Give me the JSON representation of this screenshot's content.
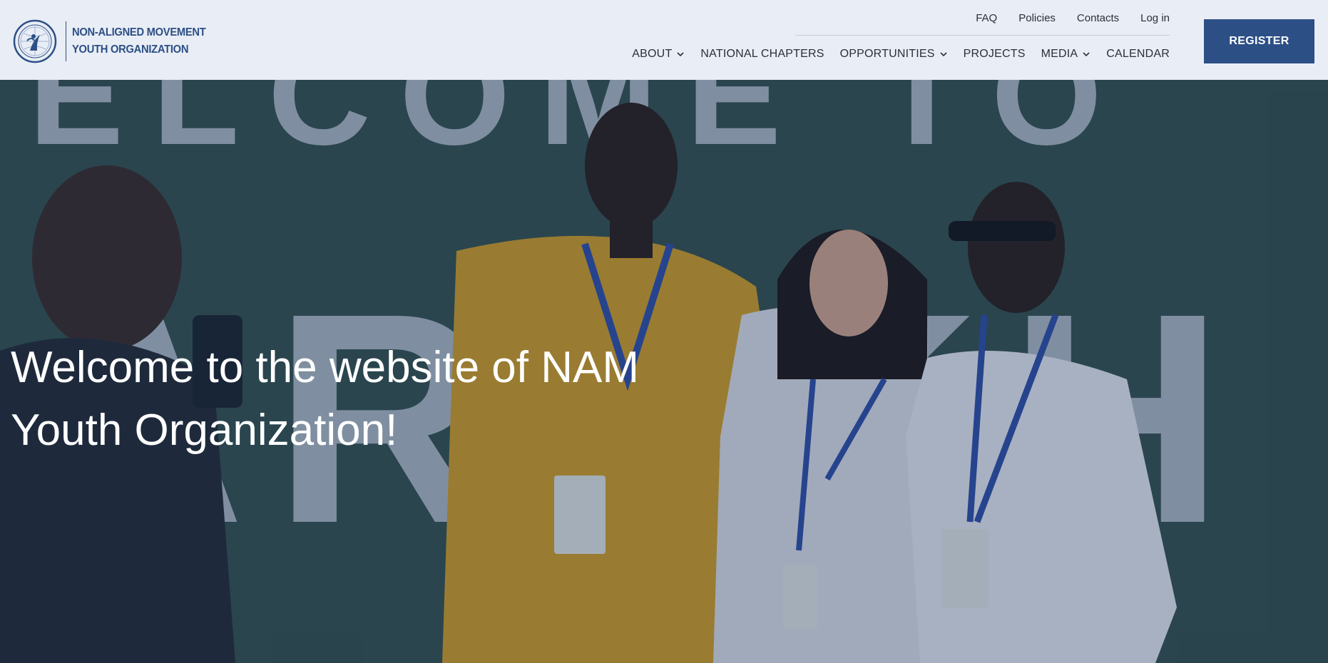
{
  "header": {
    "logo_line1": "NON-ALIGNED MOVEMENT",
    "logo_line2": "YOUTH ORGANIZATION",
    "top_links": [
      "FAQ",
      "Policies",
      "Contacts",
      "Log in"
    ],
    "nav": [
      {
        "label": "ABOUT",
        "dropdown": true
      },
      {
        "label": "NATIONAL CHAPTERS",
        "dropdown": false
      },
      {
        "label": "OPPORTUNITIES",
        "dropdown": true
      },
      {
        "label": "PROJECTS",
        "dropdown": false
      },
      {
        "label": "MEDIA",
        "dropdown": true
      },
      {
        "label": "CALENDAR",
        "dropdown": false
      }
    ],
    "register_label": "REGISTER"
  },
  "hero": {
    "title_line1": "Welcome to the website of NAM",
    "title_line2": "Youth Organization!",
    "background_letters_top": "ELCOME TO",
    "background_letters_bottom": "ARAKH"
  },
  "colors": {
    "brand": "#2c4f86",
    "header_bg": "#e9edf5",
    "text": "#2b2f38"
  },
  "icons": {
    "logo": "nam-youth-emblem",
    "dropdown": "chevron-down-icon"
  }
}
